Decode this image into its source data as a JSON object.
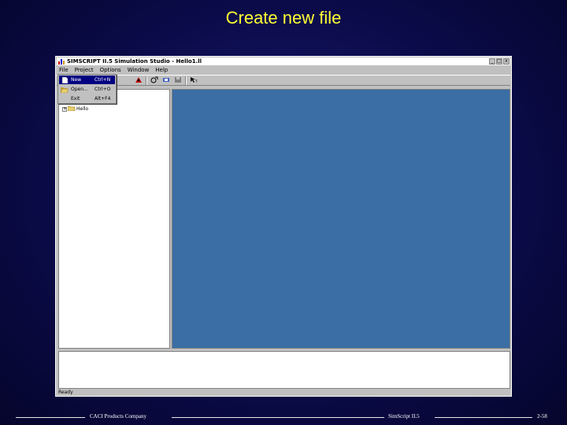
{
  "slide": {
    "title": "Create new file",
    "footer": {
      "left": "CACI Products Company",
      "center": "SimScript II.5",
      "right": "2-58"
    }
  },
  "window": {
    "title": "SIMSCRIPT II.5 Simulation Studio - Hello1.ll",
    "controls": {
      "minimize": "_",
      "maximize": "□",
      "close": "x"
    }
  },
  "menubar": {
    "items": [
      {
        "label": "File"
      },
      {
        "label": "Project"
      },
      {
        "label": "Options"
      },
      {
        "label": "Window"
      },
      {
        "label": "Help"
      }
    ]
  },
  "toolbar": {
    "buttons": [
      {
        "icon": "build-icon"
      },
      {
        "icon": "run-icon"
      },
      {
        "icon": "debug-icon"
      },
      {
        "icon": "save-icon"
      },
      {
        "icon": "help-pointer-icon"
      }
    ]
  },
  "file_menu": {
    "items": [
      {
        "label": "New",
        "shortcut": "Ctrl+N",
        "icon": "new-file-icon",
        "selected": true
      },
      {
        "label": "Open...",
        "shortcut": "Ctrl+O",
        "icon": "open-folder-icon",
        "selected": false
      },
      {
        "label": "Exit",
        "shortcut": "Alt+F4",
        "icon": "",
        "selected": false
      }
    ]
  },
  "tree": {
    "items": [
      {
        "label": "Hello",
        "icon": "folder-icon"
      }
    ]
  },
  "statusbar": {
    "text": "Ready"
  },
  "colors": {
    "slide_background": "#0b0b4a",
    "title": "#ffff33",
    "mdi_background": "#3a6ea5",
    "menu_highlight": "#000080",
    "window_chrome": "#c0c0c0"
  }
}
